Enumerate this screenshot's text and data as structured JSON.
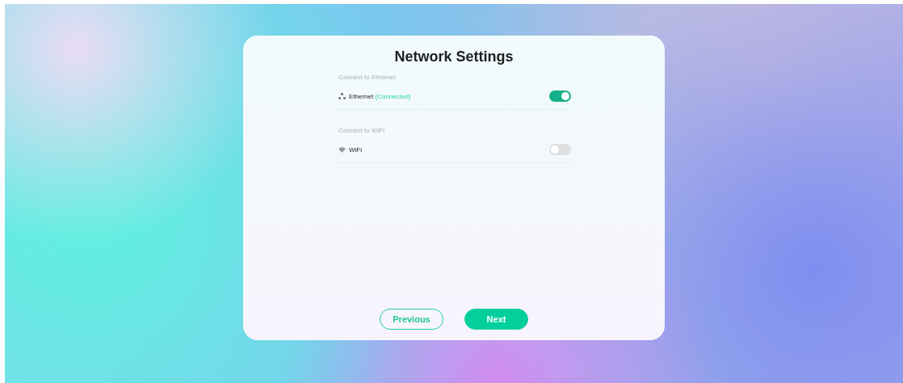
{
  "title": "Network Settings",
  "sections": [
    {
      "heading": "Connect to Ethernet",
      "kind": "ethernet",
      "label": "Ethernet",
      "status": "(Connected)",
      "on": true
    },
    {
      "heading": "Connect to WiFi",
      "kind": "wifi",
      "label": "WiFi",
      "on": false
    }
  ],
  "buttons": [
    {
      "label": "Previous",
      "kind": "secondary"
    },
    {
      "label": "Next",
      "kind": "primary"
    }
  ]
}
